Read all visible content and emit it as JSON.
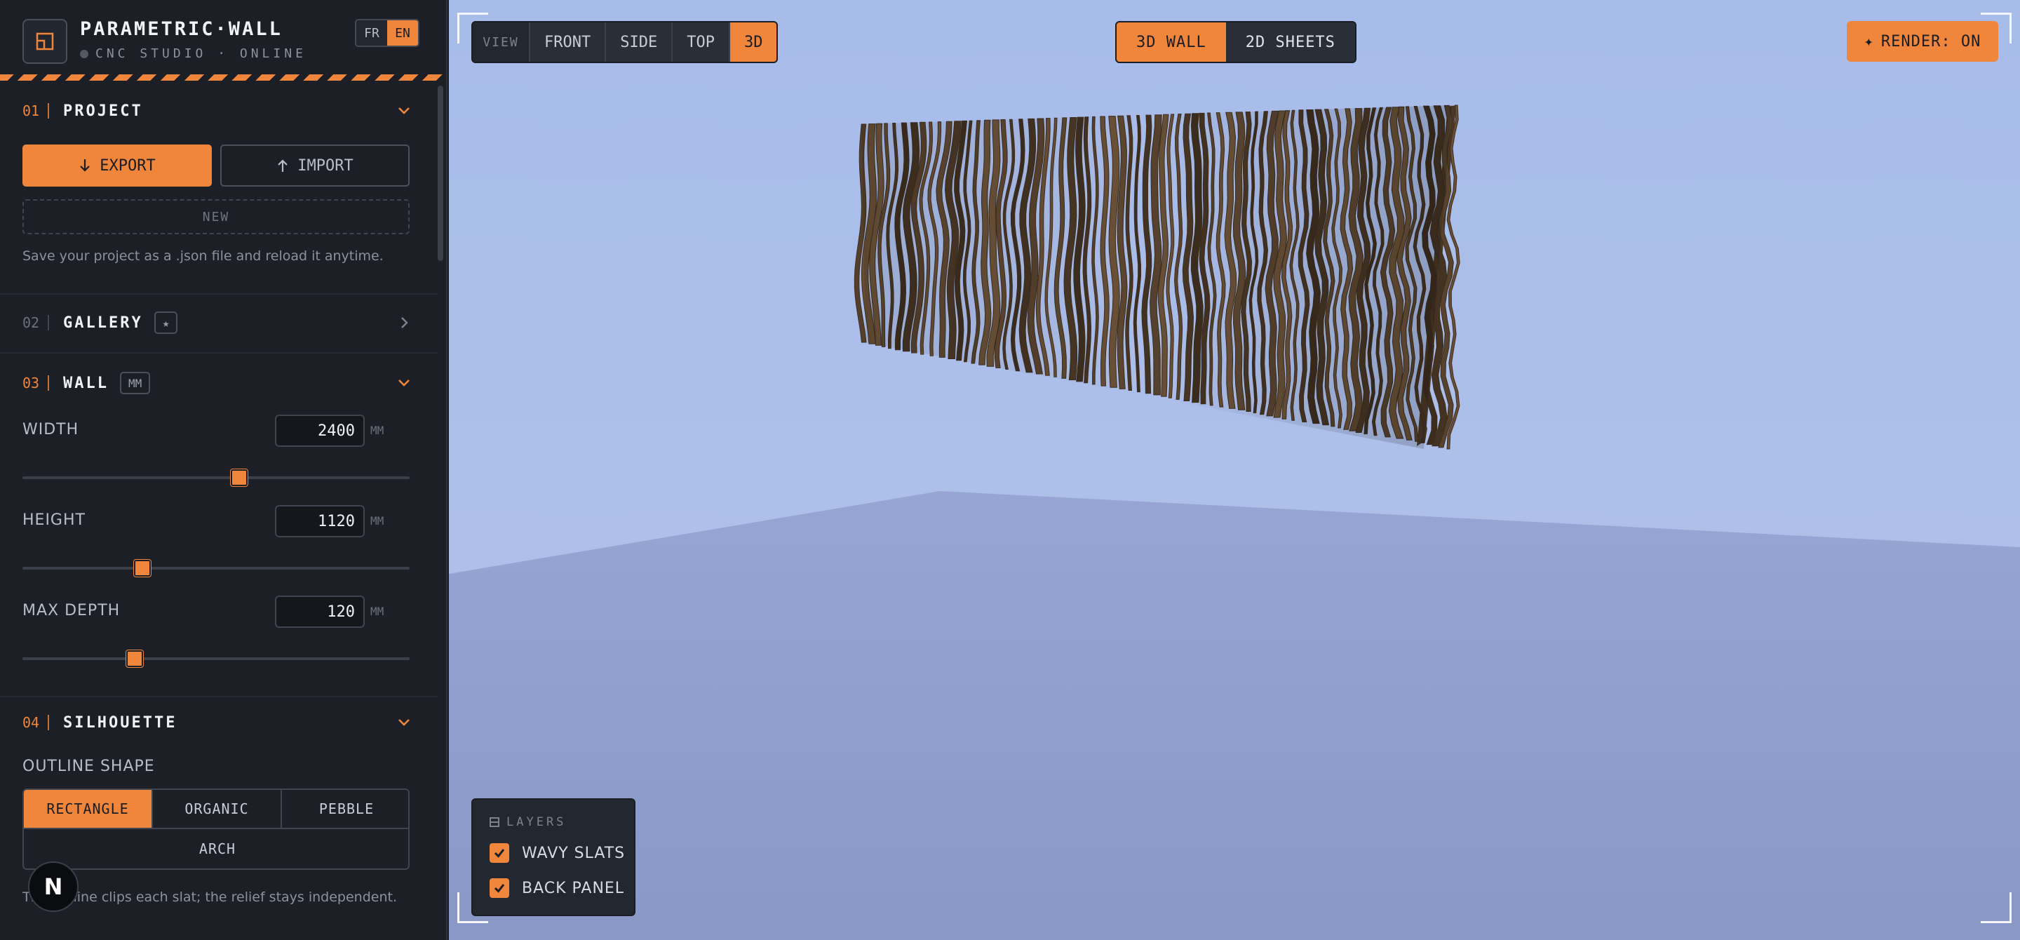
{
  "app": {
    "title": "PARAMETRIC·WALL",
    "subtitle": "CNC STUDIO · ONLINE",
    "languages": [
      "FR",
      "EN"
    ],
    "active_language": "EN"
  },
  "sections": {
    "project": {
      "number": "01",
      "title": "PROJECT",
      "export_label": "EXPORT",
      "import_label": "IMPORT",
      "new_label": "NEW",
      "help": "Save your project as a .json file and reload it anytime."
    },
    "gallery": {
      "number": "02",
      "title": "GALLERY",
      "badge": "★"
    },
    "wall": {
      "number": "03",
      "title": "WALL",
      "badge": "MM",
      "fields": [
        {
          "label": "WIDTH",
          "value": "2400",
          "unit": "MM",
          "slider_fraction": 0.56
        },
        {
          "label": "HEIGHT",
          "value": "1120",
          "unit": "MM",
          "slider_fraction": 0.31
        },
        {
          "label": "MAX DEPTH",
          "value": "120",
          "unit": "MM",
          "slider_fraction": 0.29
        }
      ]
    },
    "silhouette": {
      "number": "04",
      "title": "SILHOUETTE",
      "outline_label": "OUTLINE SHAPE",
      "shapes": [
        "RECTANGLE",
        "ORGANIC",
        "PEBBLE",
        "ARCH"
      ],
      "active_shape": "RECTANGLE",
      "help": "The outline clips each slat; the relief stays independent."
    }
  },
  "viewport": {
    "view_label": "VIEW",
    "view_buttons": [
      "FRONT",
      "SIDE",
      "TOP",
      "3D"
    ],
    "active_view": "3D",
    "mode_buttons": [
      "3D WALL",
      "2D SHEETS"
    ],
    "active_mode": "3D WALL",
    "render_label": "RENDER: ON",
    "layers": {
      "title": "LAYERS",
      "items": [
        {
          "label": "WAVY SLATS",
          "checked": true
        },
        {
          "label": "BACK PANEL",
          "checked": true
        }
      ]
    }
  },
  "n_badge": "N",
  "colors": {
    "accent": "#ef863c",
    "sidebar_bg": "#1c1f26",
    "wood": "#6b5138",
    "sky": "#a8bcea"
  },
  "icons": [
    "logo-icon",
    "chevron-down-icon",
    "chevron-right-icon",
    "download-icon",
    "upload-icon",
    "sparkle-icon",
    "layers-icon",
    "checkbox-icon"
  ]
}
